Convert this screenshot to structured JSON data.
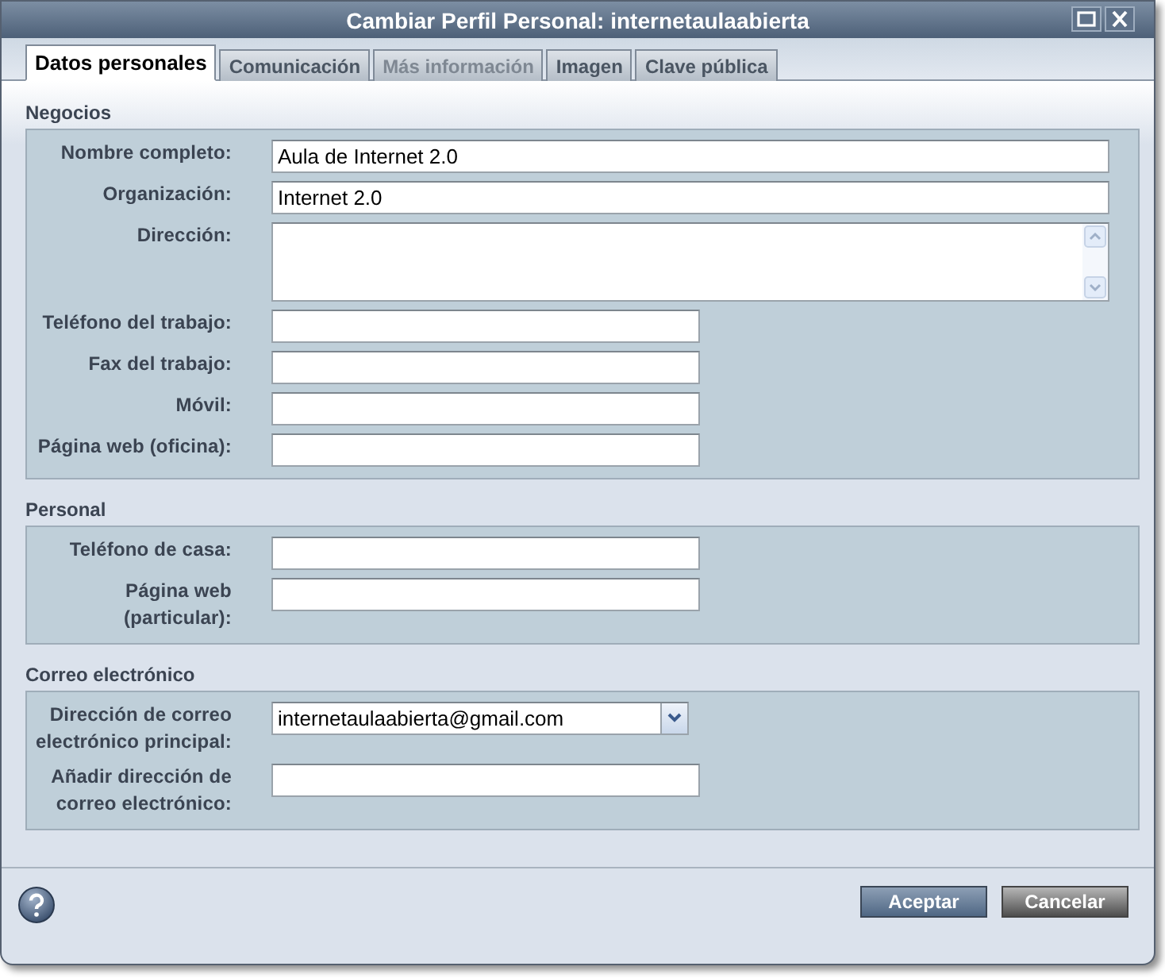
{
  "window": {
    "title": "Cambiar Perfil Personal: internetaulaabierta"
  },
  "tabs": [
    {
      "label": "Datos personales",
      "selected": true,
      "disabled": false
    },
    {
      "label": "Comunicación",
      "selected": false,
      "disabled": false
    },
    {
      "label": "Más información",
      "selected": false,
      "disabled": true
    },
    {
      "label": "Imagen",
      "selected": false,
      "disabled": false
    },
    {
      "label": "Clave pública",
      "selected": false,
      "disabled": false
    }
  ],
  "sections": [
    {
      "title": "Negocios",
      "fields": [
        {
          "label": "Nombre completo:",
          "kind": "long",
          "value": "Aula de Internet 2.0"
        },
        {
          "label": "Organización:",
          "kind": "long",
          "value": "Internet 2.0"
        },
        {
          "label": "Dirección:",
          "kind": "area"
        },
        {
          "label": "Teléfono del trabajo:",
          "kind": "short"
        },
        {
          "label": "Fax del trabajo:",
          "kind": "short"
        },
        {
          "label": "Móvil:",
          "kind": "short"
        },
        {
          "label": "Página web (oficina):",
          "kind": "short"
        }
      ]
    },
    {
      "title": "Personal",
      "fields": [
        {
          "label": "Teléfono de casa:",
          "kind": "short"
        },
        {
          "label": "Página web (particular):",
          "kind": "short"
        }
      ]
    },
    {
      "title": "Correo electrónico",
      "fields": [
        {
          "label": "Dirección de correo electrónico principal:",
          "kind": "select",
          "value": "internetaulaabierta@gmail.com"
        },
        {
          "label": "Añadir dirección de correo electrónico:",
          "kind": "short"
        }
      ]
    }
  ],
  "buttons": [
    {
      "label": "Aceptar",
      "kind": "primary"
    },
    {
      "label": "Cancelar",
      "kind": "secondary"
    }
  ]
}
